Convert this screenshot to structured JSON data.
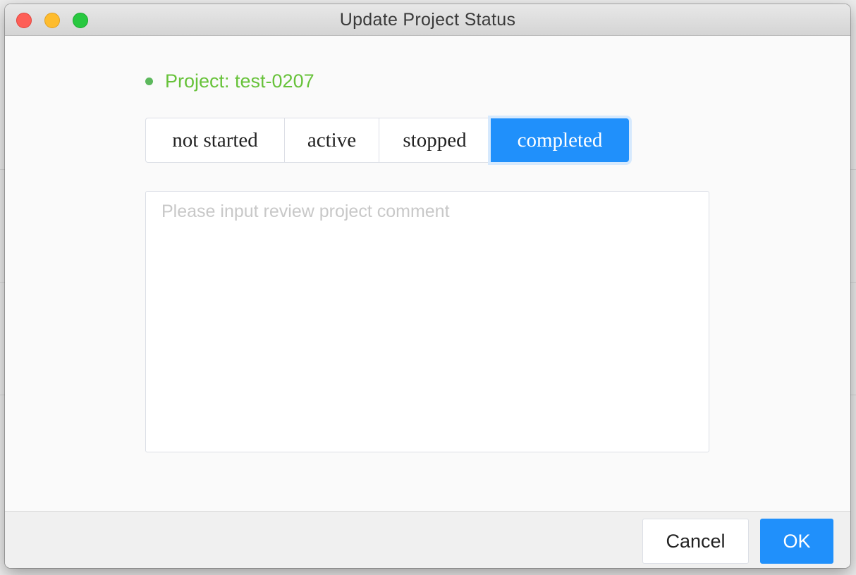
{
  "window": {
    "title": "Update Project Status"
  },
  "project": {
    "label": "Project: test-0207",
    "status_color": "#67c23a"
  },
  "status_options": {
    "items": [
      "not started",
      "active",
      "stopped",
      "completed"
    ],
    "selected": "completed",
    "accent": "#2090fb"
  },
  "comment": {
    "placeholder": "Please input review project comment",
    "value": ""
  },
  "footer": {
    "cancel_label": "Cancel",
    "ok_label": "OK"
  }
}
